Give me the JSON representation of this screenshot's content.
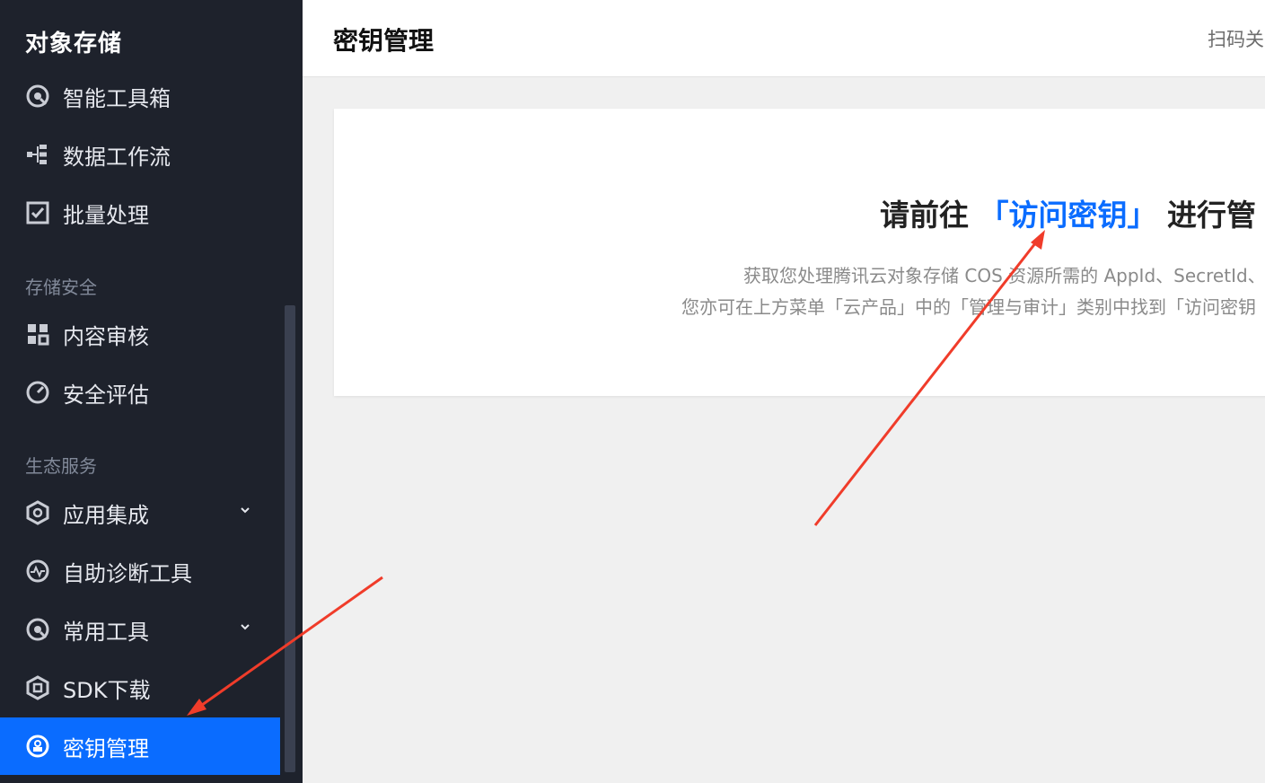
{
  "sidebar": {
    "brand": "对象存储",
    "items": [
      {
        "label": "智能工具箱",
        "icon": "toolbox-icon"
      },
      {
        "label": "数据工作流",
        "icon": "workflow-icon"
      },
      {
        "label": "批量处理",
        "icon": "checkbox-icon"
      }
    ],
    "section_security": "存储安全",
    "security_items": [
      {
        "label": "内容审核",
        "icon": "grid-icon"
      },
      {
        "label": "安全评估",
        "icon": "gauge-icon"
      }
    ],
    "section_eco": "生态服务",
    "eco_items": [
      {
        "label": "应用集成",
        "icon": "integration-icon",
        "has_chevron": true
      },
      {
        "label": "自助诊断工具",
        "icon": "pulse-icon"
      },
      {
        "label": "常用工具",
        "icon": "tools-icon",
        "has_chevron": true
      },
      {
        "label": "SDK下载",
        "icon": "sdk-icon"
      },
      {
        "label": "密钥管理",
        "icon": "key-icon",
        "active": true
      }
    ]
  },
  "header": {
    "title": "密钥管理",
    "right_link": "扫码关"
  },
  "card": {
    "headline_prefix": "请前往",
    "headline_link": "「访问密钥」",
    "headline_suffix": "进行管",
    "desc_line1": "获取您处理腾讯云对象存储 COS 资源所需的 AppId、SecretId、",
    "desc_line2": "您亦可在上方菜单「云产品」中的「管理与审计」类别中找到「访问密钥"
  },
  "colors": {
    "sidebar_bg": "#1e222c",
    "accent": "#0a6cff",
    "annotation_arrow": "#f03c2a"
  }
}
